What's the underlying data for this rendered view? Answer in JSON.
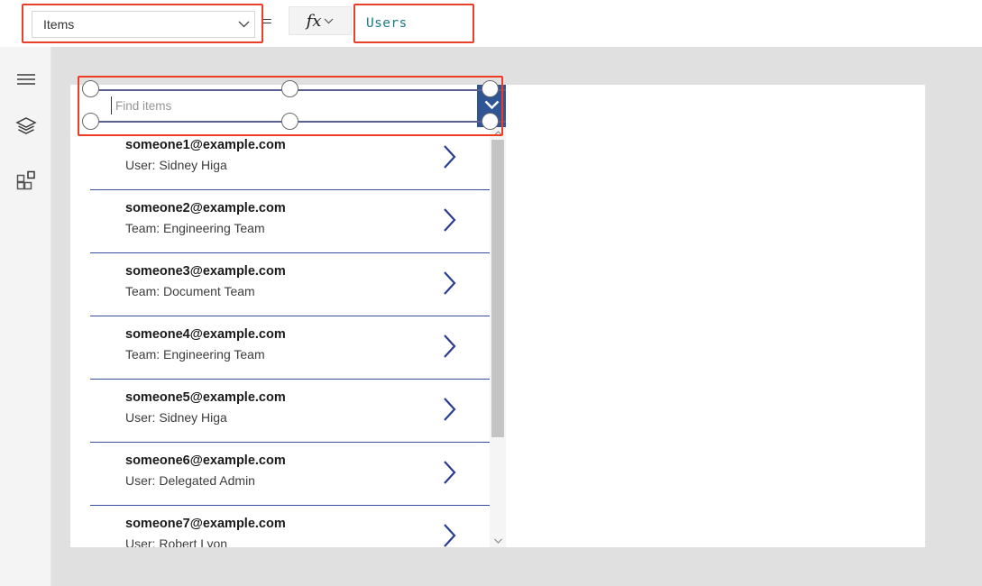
{
  "formula_bar": {
    "property_selector": {
      "value": "Items",
      "icon": "chevron-down-icon"
    },
    "equals_sign": "=",
    "fx_button": {
      "label": "fx",
      "icon": "chevron-down-icon"
    },
    "formula_value": "Users"
  },
  "left_rail": {
    "items": [
      {
        "name": "menu-hamburger",
        "icon": "hamburger-icon"
      },
      {
        "name": "tree-view",
        "icon": "layers-icon"
      },
      {
        "name": "insert",
        "icon": "components-grid-icon"
      }
    ]
  },
  "gallery": {
    "search": {
      "placeholder": "Find items",
      "value": "",
      "dropdown_icon": "chevron-down-icon"
    },
    "items": [
      {
        "title": "someone1@example.com",
        "subtitle": "User: Sidney Higa",
        "arrow": "chevron-right-icon"
      },
      {
        "title": "someone2@example.com",
        "subtitle": "Team: Engineering Team",
        "arrow": "chevron-right-icon"
      },
      {
        "title": "someone3@example.com",
        "subtitle": "Team: Document Team",
        "arrow": "chevron-right-icon"
      },
      {
        "title": "someone4@example.com",
        "subtitle": "Team: Engineering Team",
        "arrow": "chevron-right-icon"
      },
      {
        "title": "someone5@example.com",
        "subtitle": "User: Sidney Higa",
        "arrow": "chevron-right-icon"
      },
      {
        "title": "someone6@example.com",
        "subtitle": "User: Delegated Admin",
        "arrow": "chevron-right-icon"
      },
      {
        "title": "someone7@example.com",
        "subtitle": "User: Robert Lyon",
        "arrow": "chevron-right-icon"
      }
    ],
    "scrollbar": {
      "up_icon": "scroll-up-arrow-icon",
      "down_icon": "scroll-down-arrow-icon"
    }
  },
  "colors": {
    "accent_blue": "#2f5597",
    "divider_blue": "#3b4fa0",
    "formula_text": "#1b7b86",
    "annotation_red": "#ef3b24",
    "workspace_gray": "#e0e0e0",
    "selection_outline": "#5a5f8f"
  }
}
